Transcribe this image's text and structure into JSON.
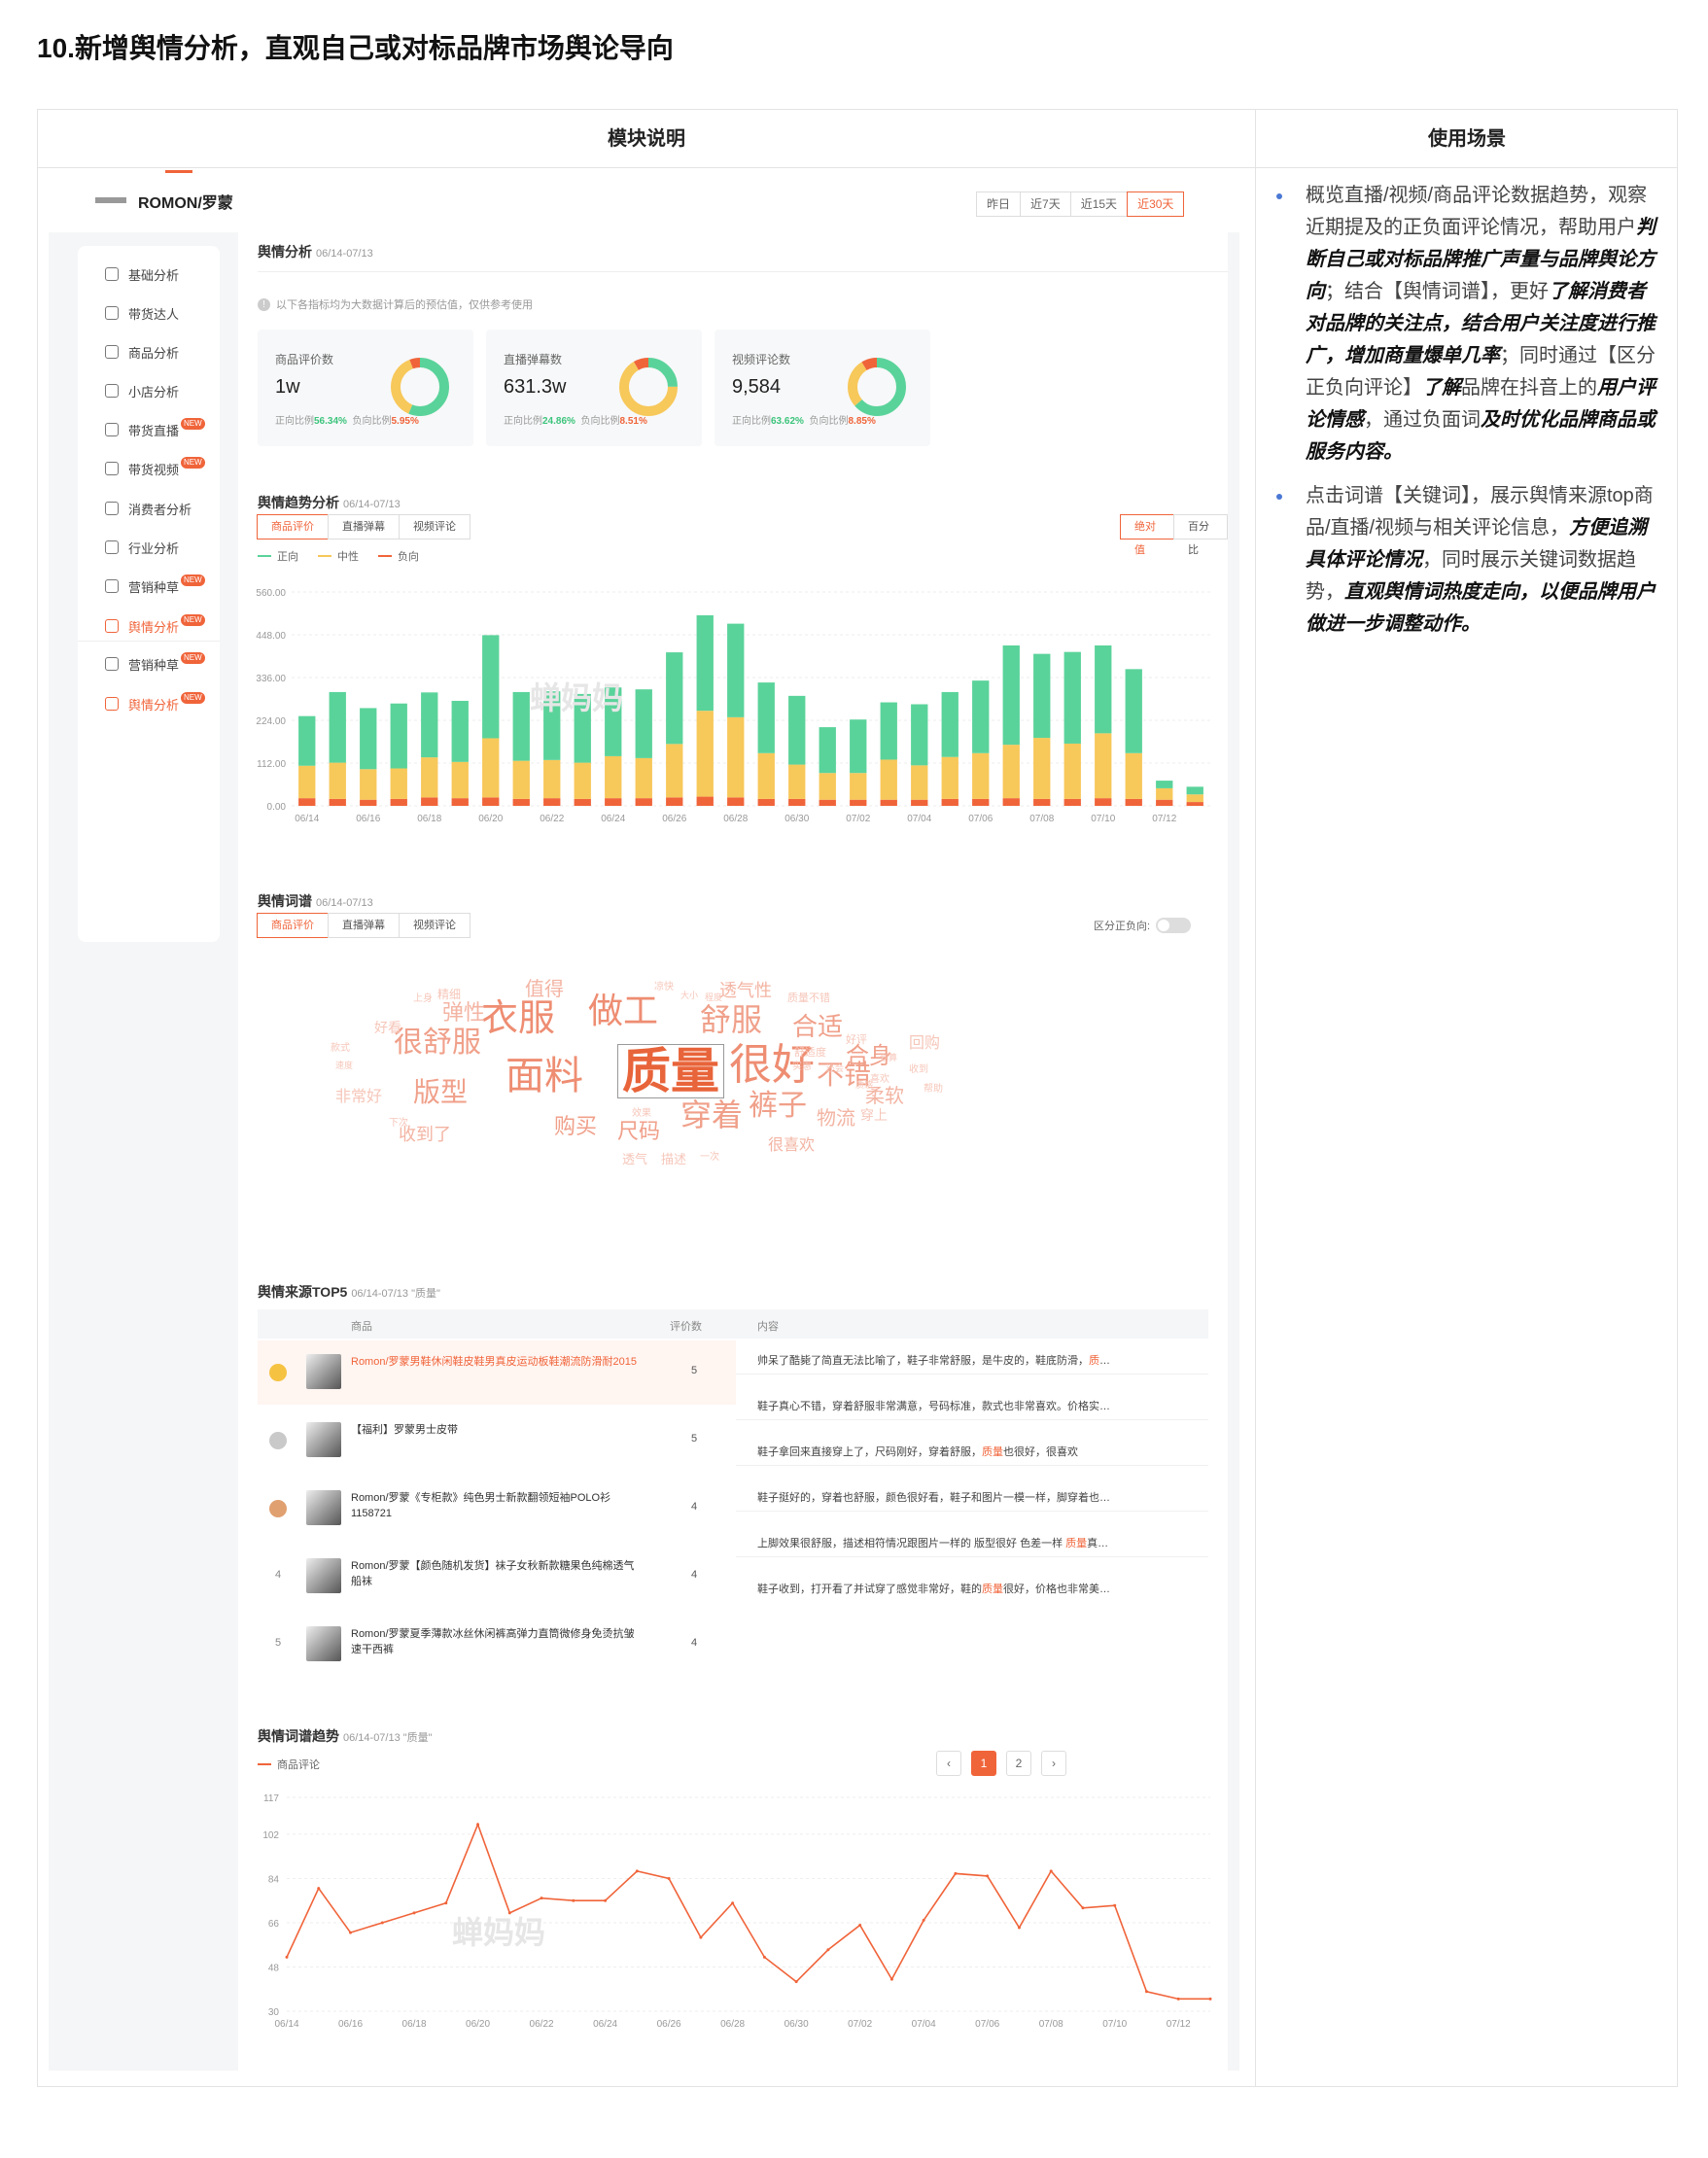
{
  "page_title": "10.新增舆情分析，直观自己或对标品牌市场舆论导向",
  "table": {
    "col1": "模块说明",
    "col2": "使用场景"
  },
  "usage": [
    [
      {
        "t": "概览直播/视频/商品评论数据趋势，观察近期提及的正负面评论情况，帮助用户"
      },
      {
        "t": "判断自己或对标品牌推广声量与品牌舆论方向",
        "b": true
      },
      {
        "t": "；结合【舆情词谱】，更好"
      },
      {
        "t": "了解消费者对品牌的关注点，结合用户关注度进行推广，增加商量爆单几率",
        "b": true
      },
      {
        "t": "；同时通过【区分正负向评论】"
      },
      {
        "t": "了解",
        "b": true
      },
      {
        "t": "品牌在抖音上的"
      },
      {
        "t": "用户评论情感",
        "b": true
      },
      {
        "t": "，通过负面词"
      },
      {
        "t": "及时优化品牌商品或服务内容。",
        "b": true
      }
    ],
    [
      {
        "t": "点击词谱【关键词】，展示舆情来源top商品/直播/视频与相关评论信息，"
      },
      {
        "t": "方便追溯具体评论情况",
        "b": true
      },
      {
        "t": "，同时展示关键词数据趋势，"
      },
      {
        "t": "直观舆情词热度走向，以便品牌用户做进一步调整动作。",
        "b": true
      }
    ]
  ],
  "app": {
    "brand": "ROMON/罗蒙",
    "date_tabs": [
      "昨日",
      "近7天",
      "近15天",
      "近30天"
    ],
    "active_date_tab": 3,
    "sidebar": [
      {
        "label": "基础分析"
      },
      {
        "label": "带货达人"
      },
      {
        "label": "商品分析"
      },
      {
        "label": "小店分析"
      },
      {
        "label": "带货直播",
        "badge": "NEW"
      },
      {
        "label": "带货视频",
        "badge": "NEW"
      },
      {
        "label": "消费者分析"
      },
      {
        "label": "行业分析"
      },
      {
        "label": "营销种草",
        "badge": "NEW"
      },
      {
        "label": "舆情分析",
        "badge": "NEW",
        "active": true
      },
      {
        "label": "营销种草",
        "badge": "NEW"
      },
      {
        "label": "舆情分析",
        "badge": "NEW",
        "active": true
      }
    ],
    "overview": {
      "title": "舆情分析",
      "date": "06/14-07/13",
      "note": "以下各指标均为大数据计算后的预估值，仅供参考使用",
      "cards": [
        {
          "label": "商品评价数",
          "value": "1w",
          "pos_label": "正向比例",
          "pos": "56.34%",
          "neg_label": "负向比例",
          "neg": "5.95%"
        },
        {
          "label": "直播弹幕数",
          "value": "631.3w",
          "pos_label": "正向比例",
          "pos": "24.86%",
          "neg_label": "负向比例",
          "neg": "8.51%"
        },
        {
          "label": "视频评论数",
          "value": "9,584",
          "pos_label": "正向比例",
          "pos": "63.62%",
          "neg_label": "负向比例",
          "neg": "8.85%"
        }
      ]
    },
    "trend": {
      "title": "舆情趋势分析",
      "date": "06/14-07/13",
      "tabs": [
        "商品评价",
        "直播弹幕",
        "视频评论"
      ],
      "mode_tabs": [
        "绝对值",
        "百分比"
      ],
      "legend": [
        "正向",
        "中性",
        "负向"
      ],
      "watermark": "蝉妈妈"
    },
    "wordcloud": {
      "title": "舆情词谱",
      "date": "06/14-07/13",
      "tabs": [
        "商品评价",
        "直播弹幕",
        "视频评论"
      ],
      "toggle_label": "区分正负向:",
      "words": [
        {
          "text": "质量",
          "s": 50,
          "c": "#e8643a",
          "bold": true
        },
        {
          "text": "很好",
          "s": 44,
          "c": "#ee8d72"
        },
        {
          "text": "面料",
          "s": 40,
          "c": "#ee8d72"
        },
        {
          "text": "衣服",
          "s": 38,
          "c": "#ee8d72"
        },
        {
          "text": "做工",
          "s": 36,
          "c": "#ee8d72"
        },
        {
          "text": "舒服",
          "s": 32,
          "c": "#f0a08a"
        },
        {
          "text": "穿着",
          "s": 32,
          "c": "#f0a08a"
        },
        {
          "text": "裤子",
          "s": 30,
          "c": "#f0a08a"
        },
        {
          "text": "很舒服",
          "s": 30,
          "c": "#f0a08a"
        },
        {
          "text": "版型",
          "s": 28,
          "c": "#f0a08a"
        },
        {
          "text": "不错",
          "s": 28,
          "c": "#f0a08a"
        },
        {
          "text": "合适",
          "s": 26,
          "c": "#f0a08a"
        },
        {
          "text": "合身",
          "s": 24,
          "c": "#f0a08a"
        },
        {
          "text": "购买",
          "s": 22,
          "c": "#f0a08a"
        },
        {
          "text": "尺码",
          "s": 22,
          "c": "#f0a08a"
        },
        {
          "text": "弹性",
          "s": 22,
          "c": "#f3b4a3"
        },
        {
          "text": "柔软",
          "s": 20,
          "c": "#f3b4a3"
        },
        {
          "text": "物流",
          "s": 20,
          "c": "#f3b4a3"
        },
        {
          "text": "收到了",
          "s": 18,
          "c": "#f3b4a3"
        },
        {
          "text": "值得",
          "s": 20,
          "c": "#f3b4a3"
        },
        {
          "text": "透气性",
          "s": 18,
          "c": "#f3b4a3"
        },
        {
          "text": "很喜欢",
          "s": 16,
          "c": "#f3b4a3"
        },
        {
          "text": "非常好",
          "s": 16,
          "c": "#f6c6b9"
        },
        {
          "text": "回购",
          "s": 16,
          "c": "#f6c6b9"
        },
        {
          "text": "穿上",
          "s": 14,
          "c": "#f6c6b9"
        },
        {
          "text": "好看",
          "s": 14,
          "c": "#f6c6b9"
        },
        {
          "text": "精细",
          "s": 12,
          "c": "#f6c6b9"
        },
        {
          "text": "透气",
          "s": 13,
          "c": "#f6c6b9"
        },
        {
          "text": "描述",
          "s": 13,
          "c": "#f6c6b9"
        },
        {
          "text": "质量不错",
          "s": 11,
          "c": "#f6c6b9"
        },
        {
          "text": "舒适度",
          "s": 11,
          "c": "#f6c6b9"
        },
        {
          "text": "好评",
          "s": 11,
          "c": "#f6c6b9"
        },
        {
          "text": "上身",
          "s": 10,
          "c": "#f6c6b9"
        },
        {
          "text": "凉快",
          "s": 10,
          "c": "#f6c6b9"
        },
        {
          "text": "款式",
          "s": 10,
          "c": "#f6c6b9"
        },
        {
          "text": "效果",
          "s": 10,
          "c": "#f6c6b9"
        },
        {
          "text": "下次",
          "s": 10,
          "c": "#f6c6b9"
        },
        {
          "text": "一次",
          "s": 10,
          "c": "#f6c6b9"
        },
        {
          "text": "喜欢",
          "s": 10,
          "c": "#f6c6b9"
        },
        {
          "text": "收到",
          "s": 10,
          "c": "#f6c6b9"
        },
        {
          "text": "帮助",
          "s": 10,
          "c": "#f6c6b9"
        },
        {
          "text": "实惠",
          "s": 10,
          "c": "#f6c6b9"
        },
        {
          "text": "大小",
          "s": 9,
          "c": "#f6c6b9"
        },
        {
          "text": "程度",
          "s": 9,
          "c": "#f6c6b9"
        },
        {
          "text": "速度",
          "s": 9,
          "c": "#f6c6b9"
        },
        {
          "text": "还会",
          "s": 9,
          "c": "#f6c6b9"
        },
        {
          "text": "划算",
          "s": 9,
          "c": "#f6c6b9"
        },
        {
          "text": "质感",
          "s": 9,
          "c": "#f6c6b9"
        }
      ]
    },
    "top5": {
      "title": "舆情来源TOP5",
      "date": "06/14-07/13 \"质量\"",
      "headers": {
        "product": "商品",
        "count": "评价数",
        "content": "内容"
      },
      "rows": [
        {
          "rank": "1",
          "name": "Romon/罗蒙男鞋休闲鞋皮鞋男真皮运动板鞋潮流防滑耐2015",
          "count": "5",
          "highlight": true
        },
        {
          "rank": "2",
          "name": "【福利】罗蒙男士皮带",
          "count": "5"
        },
        {
          "rank": "3",
          "name": "Romon/罗蒙《专柜款》纯色男士新款翻领短袖POLO衫1158721",
          "count": "4"
        },
        {
          "rank": "4",
          "name": "Romon/罗蒙【颜色随机发货】袜子女秋新款糖果色纯棉透气船袜",
          "count": "4"
        },
        {
          "rank": "5",
          "name": "Romon/罗蒙夏季薄款冰丝休闲裤高弹力直筒微修身免烫抗皱速干西裤",
          "count": "4"
        }
      ],
      "comments": [
        {
          "pre": "帅呆了酷毙了简直无法比喻了，鞋子非常舒服，是牛皮的，鞋底防滑，",
          "kw": "质",
          "post": "…"
        },
        {
          "pre": "鞋子真心不错，穿着舒服非常满意，号码标准，款式也非常喜欢。价格实…",
          "kw": "",
          "post": ""
        },
        {
          "pre": "鞋子拿回来直接穿上了，尺码刚好，穿着舒服，",
          "kw": "质量",
          "post": "也很好，很喜欢"
        },
        {
          "pre": "鞋子挺好的，穿着也舒服，颜色很好看，鞋子和图片一模一样，脚穿着也…",
          "kw": "",
          "post": ""
        },
        {
          "pre": "上脚效果很舒服，描述相符情况跟图片一样的 版型很好 色差一样 ",
          "kw": "质量",
          "post": "真…"
        },
        {
          "pre": "鞋子收到，打开看了并试穿了感觉非常好，鞋的",
          "kw": "质量",
          "post": "很好，价格也非常美…"
        }
      ],
      "pages": [
        "1",
        "2"
      ],
      "prev": "‹",
      "next": "›"
    },
    "kwtrend": {
      "title": "舆情词谱趋势",
      "date": "06/14-07/13 \"质量\"",
      "legend": "商品评论",
      "watermark": "蝉妈妈"
    }
  },
  "chart_data": [
    {
      "type": "bar",
      "stacked": true,
      "categories": [
        "06/14",
        "06/15",
        "06/16",
        "06/17",
        "06/18",
        "06/19",
        "06/20",
        "06/21",
        "06/22",
        "06/23",
        "06/24",
        "06/25",
        "06/26",
        "06/27",
        "06/28",
        "06/29",
        "06/30",
        "07/01",
        "07/02",
        "07/03",
        "07/04",
        "07/05",
        "07/06",
        "07/07",
        "07/08",
        "07/09",
        "07/10",
        "07/11",
        "07/12",
        "07/13"
      ],
      "x_tick_labels": [
        "06/14",
        "06/16",
        "06/18",
        "06/20",
        "06/22",
        "06/24",
        "06/26",
        "06/28",
        "06/30",
        "07/02",
        "07/04",
        "07/06",
        "07/08",
        "07/10",
        "07/12"
      ],
      "series": [
        {
          "name": "负向",
          "color": "#f0643a",
          "values": [
            20,
            18,
            16,
            18,
            22,
            20,
            22,
            18,
            20,
            18,
            20,
            20,
            22,
            24,
            22,
            18,
            18,
            16,
            16,
            16,
            16,
            18,
            18,
            20,
            18,
            18,
            20,
            18,
            16,
            10
          ]
        },
        {
          "name": "中性",
          "color": "#f7c85a",
          "values": [
            85,
            95,
            80,
            80,
            105,
            95,
            155,
            100,
            100,
            95,
            110,
            105,
            140,
            225,
            210,
            120,
            90,
            70,
            70,
            105,
            90,
            110,
            120,
            140,
            160,
            145,
            170,
            120,
            30,
            20
          ]
        },
        {
          "name": "正向",
          "color": "#5ad39a",
          "values": [
            130,
            185,
            160,
            170,
            170,
            160,
            270,
            180,
            180,
            180,
            180,
            180,
            240,
            250,
            245,
            185,
            180,
            120,
            140,
            150,
            160,
            170,
            190,
            260,
            220,
            240,
            230,
            220,
            20,
            20
          ]
        }
      ],
      "ylim": [
        0,
        560
      ],
      "yticks": [
        "0.00",
        "112.00",
        "224.00",
        "336.00",
        "448.00",
        "560.00"
      ],
      "legend_position": "top-left"
    },
    {
      "type": "line",
      "x": [
        "06/14",
        "06/15",
        "06/16",
        "06/17",
        "06/18",
        "06/19",
        "06/20",
        "06/21",
        "06/22",
        "06/23",
        "06/24",
        "06/25",
        "06/26",
        "06/27",
        "06/28",
        "06/29",
        "06/30",
        "07/01",
        "07/02",
        "07/03",
        "07/04",
        "07/05",
        "07/06",
        "07/07",
        "07/08",
        "07/09",
        "07/10",
        "07/11",
        "07/12",
        "07/13"
      ],
      "x_tick_labels": [
        "06/14",
        "06/16",
        "06/18",
        "06/20",
        "06/22",
        "06/24",
        "06/26",
        "06/28",
        "06/30",
        "07/02",
        "07/04",
        "07/06",
        "07/08",
        "07/10",
        "07/12"
      ],
      "series": [
        {
          "name": "商品评论",
          "color": "#f0643a",
          "values": [
            52,
            80,
            62,
            66,
            70,
            74,
            106,
            70,
            76,
            75,
            75,
            87,
            84,
            60,
            74,
            52,
            42,
            55,
            65,
            43,
            67,
            86,
            85,
            64,
            87,
            72,
            73,
            38,
            35,
            35
          ]
        }
      ],
      "ylim": [
        30,
        117
      ],
      "yticks": [
        "30",
        "48",
        "66",
        "84",
        "102",
        "117"
      ],
      "legend_position": "top-left"
    }
  ]
}
